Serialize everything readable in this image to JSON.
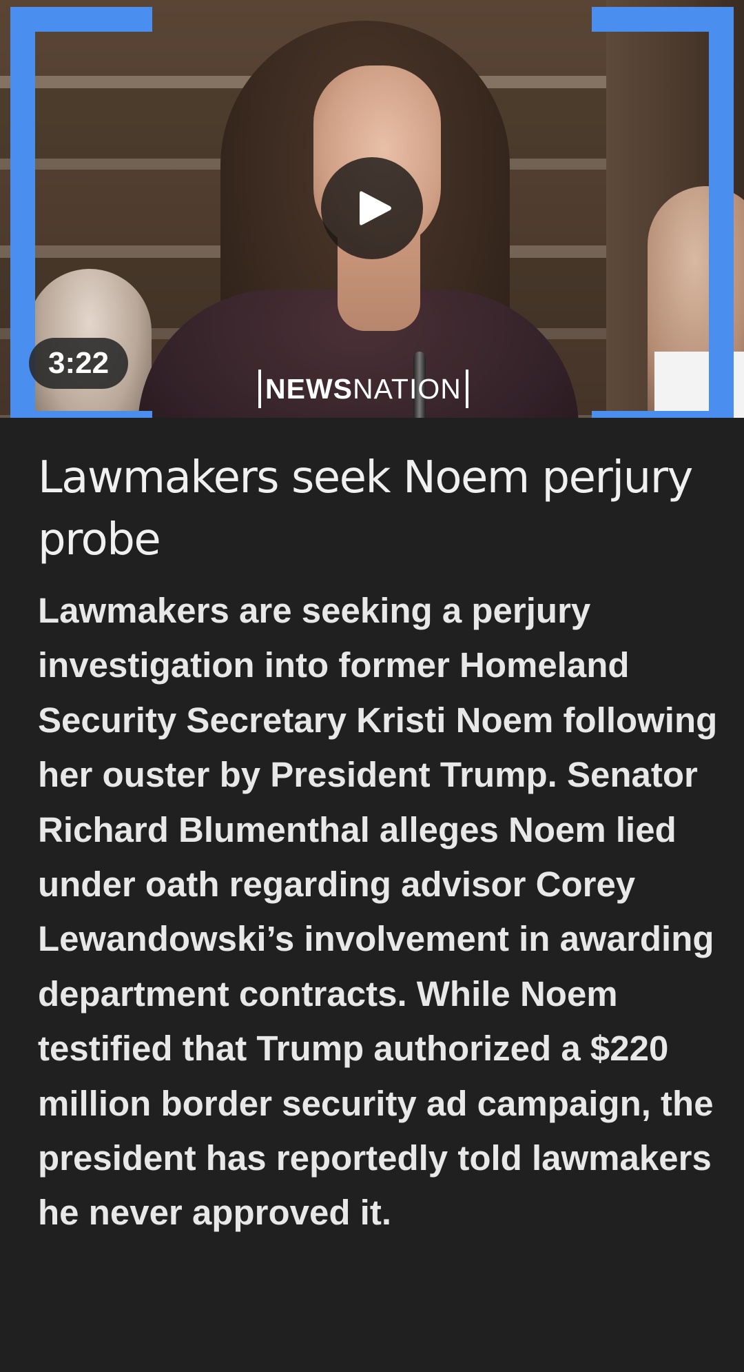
{
  "video": {
    "duration": "3:22",
    "watermark_bold": "NEWS",
    "watermark_light": "NATION",
    "play_icon": "play-icon",
    "bracket_color": "#4a8ef0"
  },
  "article": {
    "headline": "Lawmakers seek Noem perjury probe",
    "summary": "Lawmakers are seeking a perjury investigation into former Homeland Security Secretary Kristi Noem following her ouster by President Trump. Senator Richard Blumenthal alleges Noem lied under oath regarding advisor Corey Lewandowski’s involvement in awarding department contracts. While Noem testified that Trump authorized a $220 million border security ad campaign, the president has reportedly told lawmakers he never approved it."
  },
  "colors": {
    "background": "#202020",
    "text": "#ececec"
  }
}
